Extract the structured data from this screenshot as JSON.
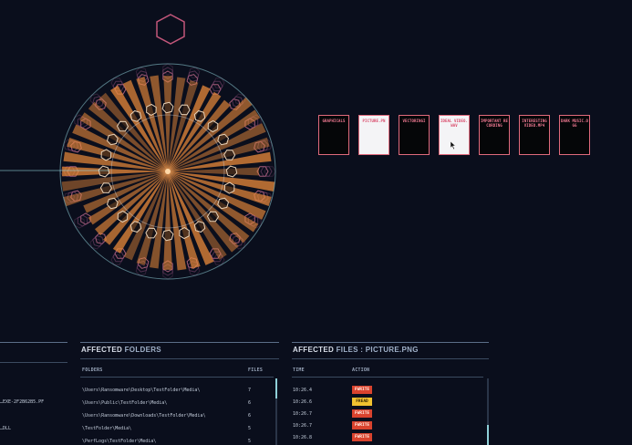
{
  "colors": {
    "background": "#0a0e1c",
    "accent_orange": "#e98a3a",
    "accent_pink": "#e06a7c",
    "accent_cyan": "#8fd0d8",
    "fwrite": "#d9432e",
    "fread": "#f2c230"
  },
  "visualization": {
    "ray_count": 44,
    "hexagon_ring_count": 24
  },
  "file_cards": [
    {
      "name": "GRAPHICALS",
      "light": false
    },
    {
      "name": "PICTURE.PN",
      "light": true
    },
    {
      "name": "VECTORINGI",
      "light": false
    },
    {
      "name": "IDEAL VIDEO.WAV",
      "light": true
    },
    {
      "name": "IMPORTANT RECORDING",
      "light": false
    },
    {
      "name": "INTERESTING VIDEO.MP4",
      "light": false
    },
    {
      "name": "DARK MUSIC.OGG",
      "light": false
    }
  ],
  "left_panel": {
    "rows": [
      "…EXE-2F2B62B5.PF",
      "…DLL"
    ]
  },
  "folders_panel": {
    "title_prefix": "AFFECTED",
    "title_accent": "FOLDERS",
    "col_folders": "FOLDERS",
    "col_files": "FILES",
    "rows": [
      {
        "path": "\\Users\\Ransomware\\Desktop\\TestFolder\\Media\\",
        "files": "7"
      },
      {
        "path": "\\Users\\Public\\TestFolder\\Media\\",
        "files": "6"
      },
      {
        "path": "\\Users\\Ransomware\\Downloads\\TestFolder\\Media\\",
        "files": "6"
      },
      {
        "path": "\\TestFolder\\Media\\",
        "files": "5"
      },
      {
        "path": "\\PerfLogs\\TestFolder\\Media\\",
        "files": "5"
      }
    ],
    "scroll_fraction": 0.3
  },
  "files_panel": {
    "title_prefix": "AFFECTED",
    "title_accent": "FILES : PICTURE.PNG",
    "col_time": "TIME",
    "col_action": "ACTION",
    "rows": [
      {
        "time": "10:26.4",
        "action": "FWRITE"
      },
      {
        "time": "10:26.6",
        "action": "FREAD"
      },
      {
        "time": "10:26.7",
        "action": "FWRITE"
      },
      {
        "time": "10:26.7",
        "action": "FWRITE"
      },
      {
        "time": "10:26.8",
        "action": "FWRITE"
      }
    ],
    "scroll_fraction": 0.3
  }
}
